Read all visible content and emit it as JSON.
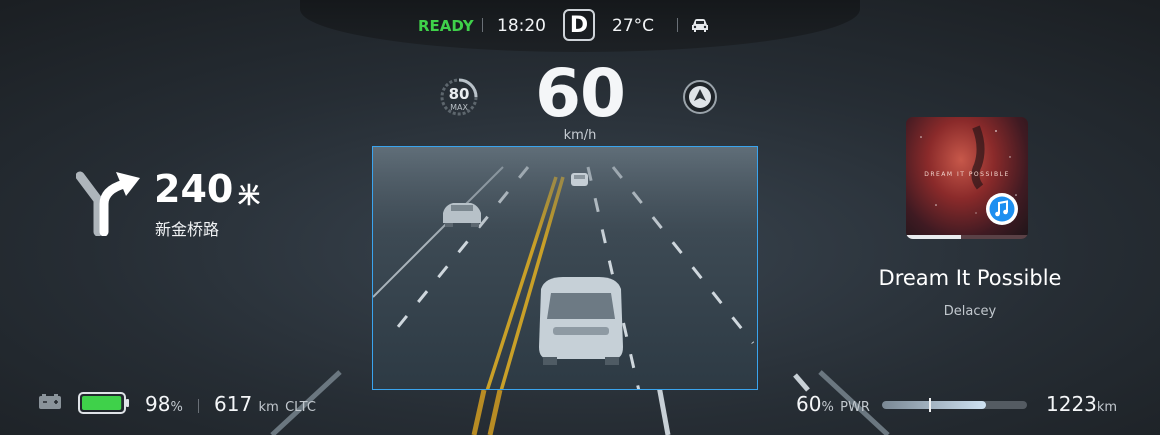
{
  "status": {
    "ready": "READY",
    "time": "18:20",
    "gear": "D",
    "temperature": "27°C",
    "icons": [
      "car-icon"
    ]
  },
  "speed": {
    "value": "60",
    "unit": "km/h",
    "limit": "80",
    "limit_label": "MAX"
  },
  "navigation": {
    "distance": "240",
    "distance_unit": "米",
    "road": "新金桥路",
    "maneuver_icon": "turn-right-icon"
  },
  "media": {
    "album_text": "DREAM IT POSSIBLE",
    "song": "Dream It Possible",
    "artist": "Delacey",
    "progress": 0.45,
    "badge_icon": "music-app-icon"
  },
  "bottom": {
    "battery_percent": "98",
    "battery_percent_unit": "%",
    "range": "617",
    "range_unit": "km",
    "range_standard": "CLTC",
    "power_percent": "60",
    "power_percent_unit": "%",
    "power_label": "PWR",
    "power_level": 0.72,
    "odometer": "1223",
    "odometer_unit": "km"
  },
  "colors": {
    "ready": "#3fd14a",
    "battery": "#3fd14a",
    "camera_border": "#3aa4ee"
  }
}
